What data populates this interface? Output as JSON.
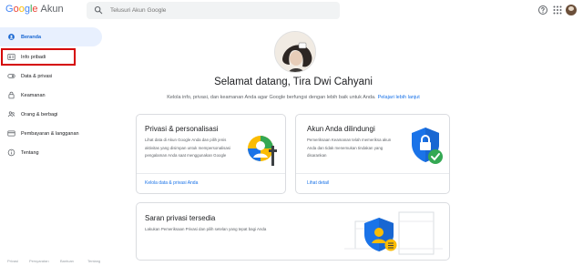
{
  "header": {
    "logo_google": "Google",
    "logo_akun": "Akun",
    "search_placeholder": "Telusuri Akun Google"
  },
  "sidebar": {
    "items": [
      {
        "label": "Beranda",
        "icon": "home-icon"
      },
      {
        "label": "Info pribadi",
        "icon": "person-card-icon"
      },
      {
        "label": "Data & privasi",
        "icon": "toggle-icon"
      },
      {
        "label": "Keamanan",
        "icon": "lock-icon"
      },
      {
        "label": "Orang & berbagi",
        "icon": "people-icon"
      },
      {
        "label": "Pembayaran & langganan",
        "icon": "credit-card-icon"
      },
      {
        "label": "Tentang",
        "icon": "info-icon"
      }
    ]
  },
  "footer": {
    "links": [
      "Privasi",
      "Persyaratan",
      "Bantuan",
      "Tentang"
    ]
  },
  "main": {
    "welcome": "Selamat datang, Tira Dwi Cahyani",
    "subtitle": "Kelola info, privasi, dan keamanan Anda agar Google berfungsi dengan lebih baik untuk Anda.",
    "subtitle_link": "Pelajari lebih lanjut",
    "cards": {
      "privacy": {
        "title": "Privasi & personalisasi",
        "body": "Lihat data di Akun Google Anda dan pilih jenis aktivitas yang disimpan untuk mempersonalisasi pengalaman Anda saat menggunakan Google",
        "link": "Kelola data & privasi Anda"
      },
      "security": {
        "title": "Akun Anda dilindungi",
        "body": "Pemeriksaan Keamanan telah memeriksa akun Anda dan tidak menemukan tindakan yang disarankan",
        "link": "Lihat detail"
      },
      "suggestions": {
        "title": "Saran privasi tersedia",
        "body": "Lakukan Pemeriksaan Privasi dan pilih setelan yang tepat bagi Anda"
      }
    }
  },
  "colors": {
    "blue": "#1a73e8",
    "red_highlight": "#d50000",
    "active_bg": "#e8f0fe"
  }
}
